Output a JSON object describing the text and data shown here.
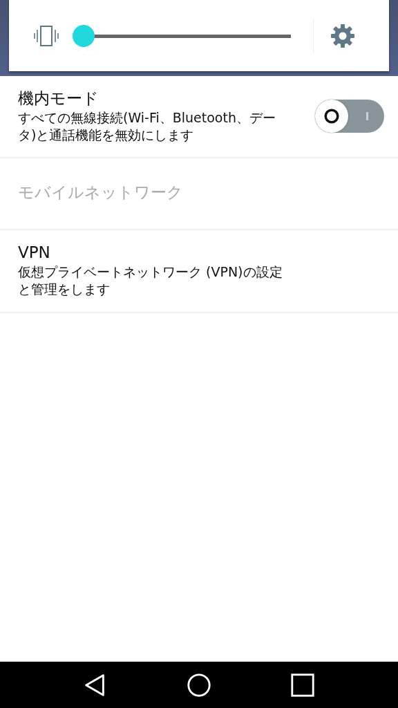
{
  "quick_panel": {
    "volume_slider": {
      "level": 0
    }
  },
  "settings": [
    {
      "kind": "toggle",
      "title": "機内モード",
      "summary": "すべての無線接続(Wi-Fi、Bluetooth、データ)と通話機能を無効にします",
      "on": false,
      "disabled": false
    },
    {
      "kind": "plain",
      "title": "モバイルネットワーク",
      "disabled": true
    },
    {
      "kind": "plain",
      "title": "VPN",
      "summary": "仮想プライベートネットワーク (VPN)の設定と管理をします",
      "disabled": false
    }
  ]
}
